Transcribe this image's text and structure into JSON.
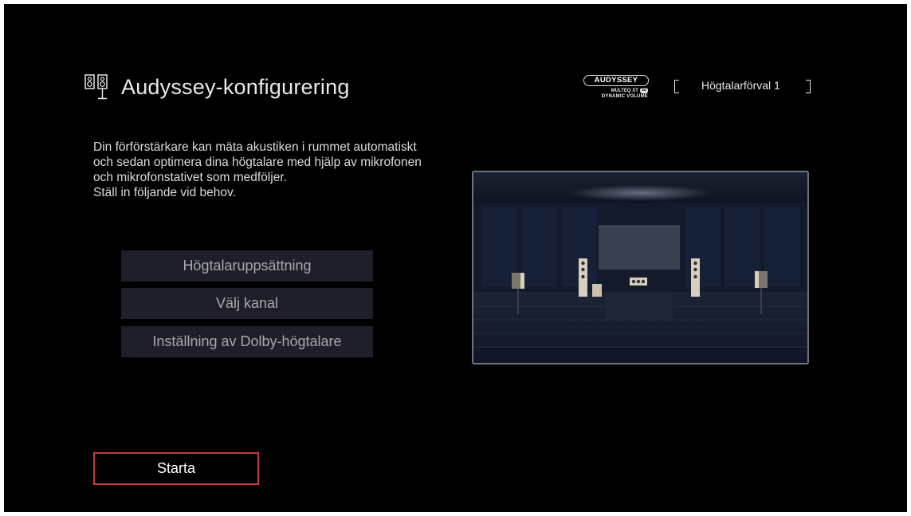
{
  "header": {
    "title": "Audyssey-konfigurering",
    "title_icon": "speaker-pair-icon",
    "brand": {
      "name": "AUDYSSEY",
      "line1": "MULTEQ XT",
      "badge": "32",
      "line2": "DYNAMIC VOLUME"
    },
    "preset_label": "Högtalarförval 1"
  },
  "description": [
    "Din förförstärkare kan mäta akustiken i rummet automatiskt",
    "och sedan optimera dina högtalare med hjälp av mikrofonen",
    "och mikrofonstativet som medföljer.",
    "Ställ in följande vid behov."
  ],
  "menu": [
    {
      "label": "Högtalaruppsättning"
    },
    {
      "label": "Välj kanal"
    },
    {
      "label": "Inställning av Dolby-högtalare"
    }
  ],
  "start_label": "Starta",
  "colors": {
    "background": "#000000",
    "button_bg": "#1e1f2a",
    "button_text": "#a8a8ab",
    "focus_border": "#c93a37",
    "text": "#e9e9e9"
  }
}
